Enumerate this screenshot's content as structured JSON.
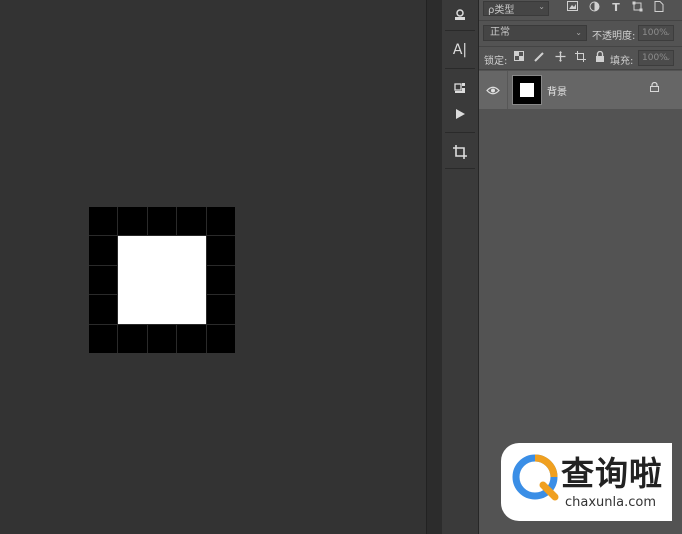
{
  "layers_panel": {
    "filter_kind_label": "ρ类型",
    "blend_mode": "正常",
    "opacity_label": "不透明度:",
    "opacity_value": "100%",
    "lock_label": "锁定:",
    "fill_label": "填充:",
    "fill_value": "100%",
    "layers": [
      {
        "name": "背景",
        "visible": true,
        "locked": true
      }
    ]
  },
  "toolbar": {
    "tools": [
      "stamp-icon",
      "type-tool-icon",
      "3d-cube-icon",
      "play-icon",
      "crop-icon"
    ]
  },
  "watermark": {
    "title": "查询啦",
    "url": "chaxunla.com"
  },
  "colors": {
    "canvas_bg": "#333333",
    "panel_bg": "#535353",
    "selected_layer": "#666666",
    "watermark_blue": "#3a8ee6",
    "watermark_orange": "#f0a020"
  }
}
